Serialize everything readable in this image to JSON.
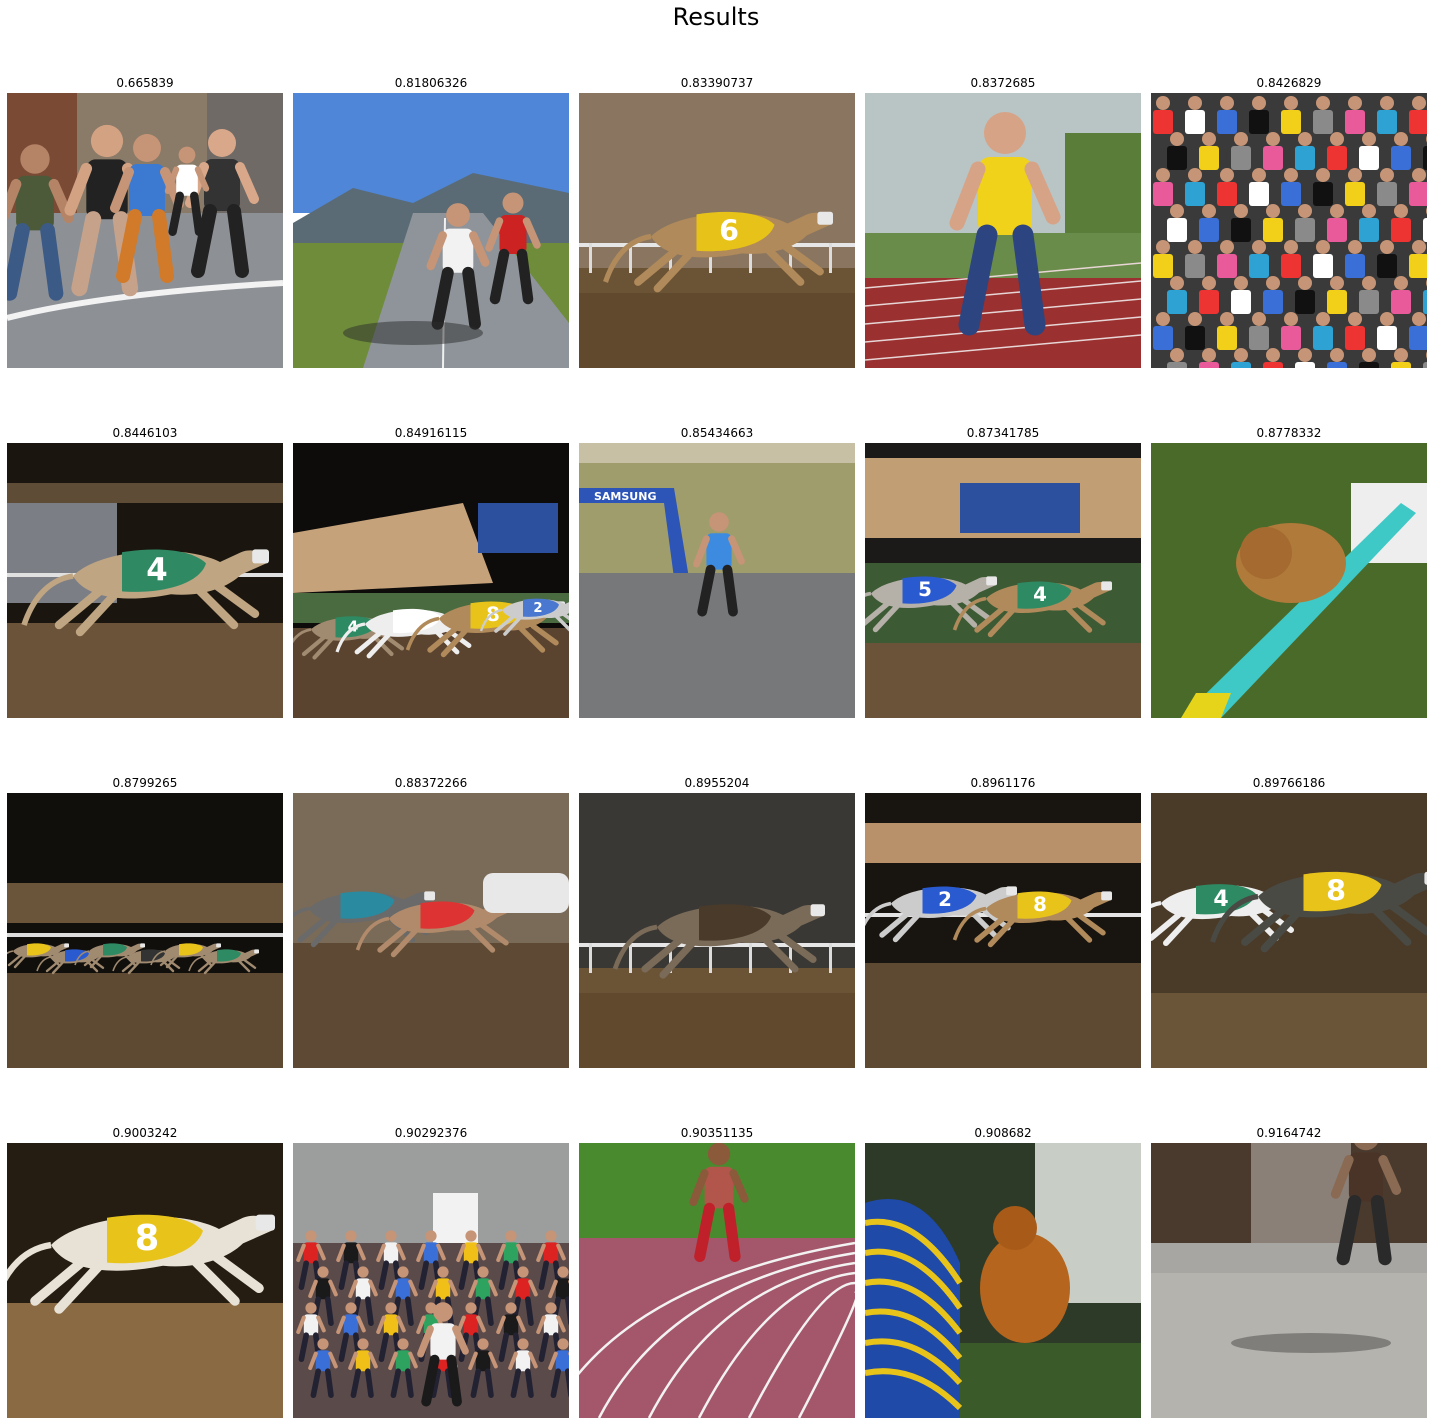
{
  "figure": {
    "title": "Results",
    "results": [
      {
        "score": "0.665839",
        "scene": "street-race-runners"
      },
      {
        "score": "0.81806326",
        "scene": "mountain-road-runners"
      },
      {
        "score": "0.83390737",
        "scene": "greyhound-6-track"
      },
      {
        "score": "0.8372685",
        "scene": "girl-running-track"
      },
      {
        "score": "0.8426829",
        "scene": "marathon-crowd"
      },
      {
        "score": "0.8446103",
        "scene": "greyhound-4-night"
      },
      {
        "score": "0.84916115",
        "scene": "greyhound-pack-night"
      },
      {
        "score": "0.85434663",
        "scene": "road-race-arch"
      },
      {
        "score": "0.87341785",
        "scene": "greyhounds-5-4"
      },
      {
        "score": "0.8778332",
        "scene": "agility-dog-ramp"
      },
      {
        "score": "0.8799265",
        "scene": "greyhound-pack-far"
      },
      {
        "score": "0.88372266",
        "scene": "greyhounds-closeup"
      },
      {
        "score": "0.8955204",
        "scene": "greyhound-single"
      },
      {
        "score": "0.8961176",
        "scene": "greyhounds-2-8"
      },
      {
        "score": "0.89766186",
        "scene": "greyhounds-4-8"
      },
      {
        "score": "0.9003242",
        "scene": "greyhound-8"
      },
      {
        "score": "0.90292376",
        "scene": "kids-fun-run"
      },
      {
        "score": "0.90351135",
        "scene": "sprinter-track"
      },
      {
        "score": "0.908682",
        "scene": "golden-retriever-agility"
      },
      {
        "score": "0.9164742",
        "scene": "runner-path"
      }
    ]
  }
}
